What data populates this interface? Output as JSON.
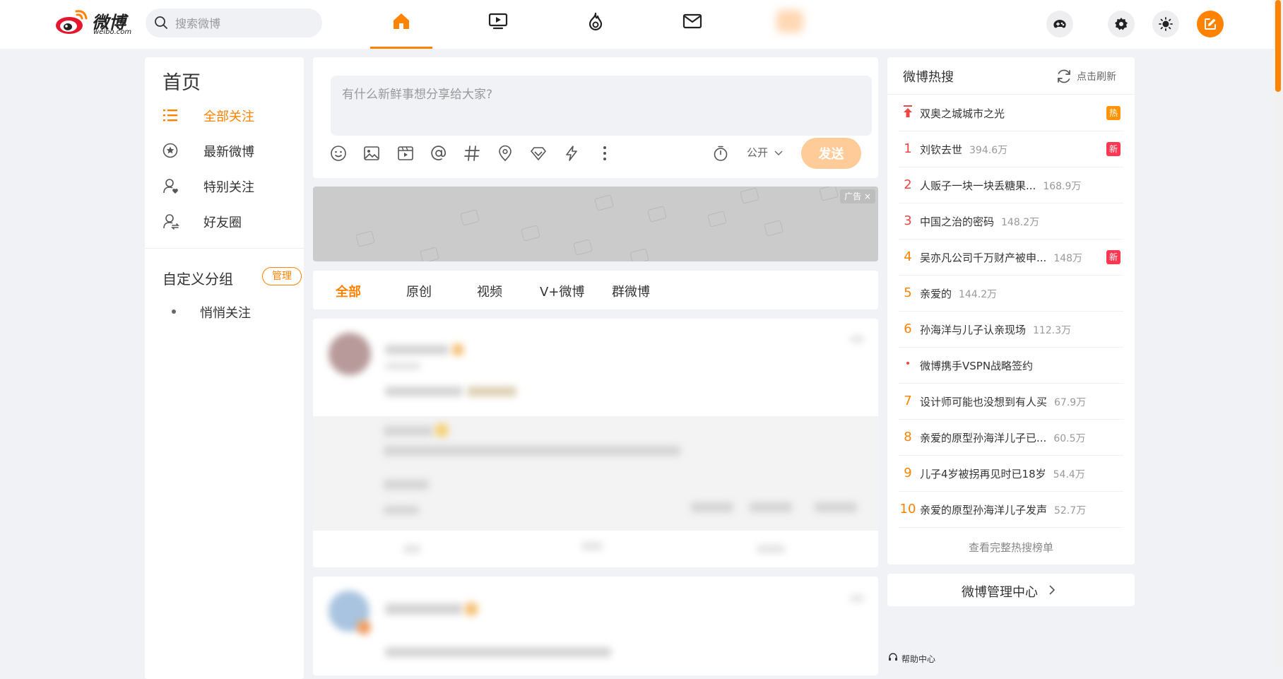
{
  "brand": {
    "logo_text": "微博",
    "logo_sub": "weibo.com",
    "accent": "#ff8200"
  },
  "search": {
    "placeholder": "搜索微博"
  },
  "nav": {
    "items": [
      {
        "icon": "home-icon",
        "active": true
      },
      {
        "icon": "video-icon",
        "active": false
      },
      {
        "icon": "hot-flame-icon",
        "active": false
      },
      {
        "icon": "message-icon",
        "active": false
      }
    ]
  },
  "tools": [
    "game-icon",
    "settings-icon",
    "theme-sun-icon",
    "compose-icon"
  ],
  "sidebar": {
    "title": "首页",
    "items": [
      {
        "label": "全部关注",
        "icon": "list-icon",
        "active": true
      },
      {
        "label": "最新微博",
        "icon": "star-icon",
        "active": false
      },
      {
        "label": "特别关注",
        "icon": "user-heart-icon",
        "active": false
      },
      {
        "label": "好友圈",
        "icon": "user-swap-icon",
        "active": false
      }
    ],
    "group_title": "自定义分组",
    "manage_label": "管理",
    "groups": [
      {
        "label": "悄悄关注"
      }
    ]
  },
  "composer": {
    "placeholder": "有什么新鲜事想分享给大家?",
    "visibility": "公开",
    "send_label": "发送"
  },
  "ad": {
    "tag": "广告 ×"
  },
  "feed_tabs": [
    {
      "label": "全部",
      "active": true
    },
    {
      "label": "原创",
      "active": false
    },
    {
      "label": "视频",
      "active": false
    },
    {
      "label": "V+微博",
      "active": false
    },
    {
      "label": "群微博",
      "active": false
    }
  ],
  "hot_search": {
    "title": "微博热搜",
    "refresh_label": "点击刷新",
    "items": [
      {
        "rank": "",
        "title": "双奥之城城市之光",
        "count": "",
        "badge": "热"
      },
      {
        "rank": "1",
        "title": "刘钦去世",
        "count": "394.6万",
        "badge": "新"
      },
      {
        "rank": "2",
        "title": "人贩子一块一块丢糖果...",
        "count": "168.9万",
        "badge": ""
      },
      {
        "rank": "3",
        "title": "中国之治的密码",
        "count": "148.2万",
        "badge": ""
      },
      {
        "rank": "4",
        "title": "吴亦凡公司千万财产被申...",
        "count": "148万",
        "badge": "新"
      },
      {
        "rank": "5",
        "title": "亲爱的",
        "count": "144.2万",
        "badge": ""
      },
      {
        "rank": "6",
        "title": "孙海洋与儿子认亲现场",
        "count": "112.3万",
        "badge": ""
      },
      {
        "rank": "•",
        "title": "微博携手VSPN战略签约",
        "count": "",
        "badge": ""
      },
      {
        "rank": "7",
        "title": "设计师可能也没想到有人买",
        "count": "67.9万",
        "badge": ""
      },
      {
        "rank": "8",
        "title": "亲爱的原型孙海洋儿子已...",
        "count": "60.5万",
        "badge": ""
      },
      {
        "rank": "9",
        "title": "儿子4岁被拐再见时已18岁",
        "count": "54.4万",
        "badge": ""
      },
      {
        "rank": "10",
        "title": "亲爱的原型孙海洋儿子发声",
        "count": "52.7万",
        "badge": ""
      }
    ],
    "more_label": "查看完整热搜榜单"
  },
  "manage_center": {
    "label": "微博管理中心"
  },
  "help": {
    "label": "帮助中心"
  }
}
